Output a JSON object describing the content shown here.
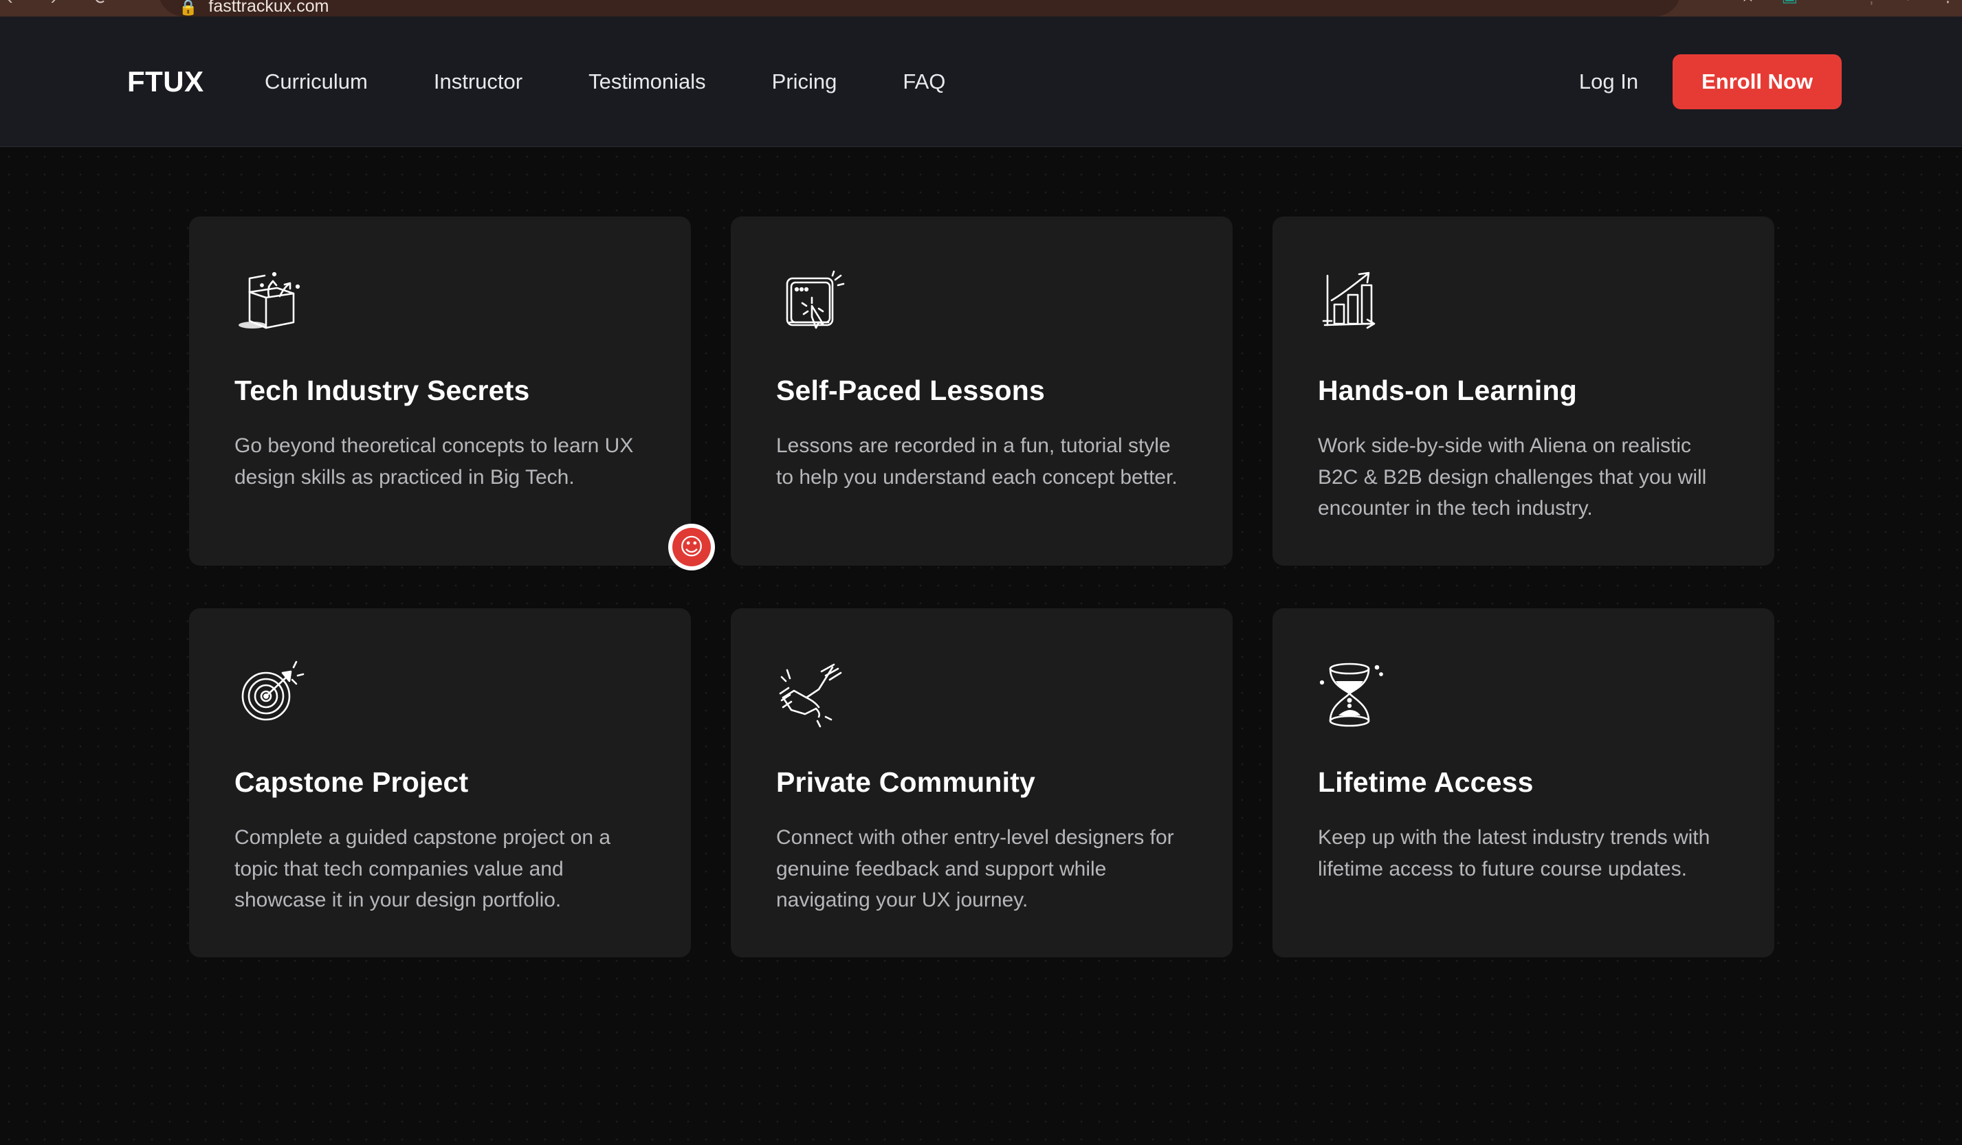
{
  "browser": {
    "url": "fasttrackux.com",
    "lock_icon": "lock-icon",
    "back_icon": "‹",
    "forward_icon": "›",
    "reload_icon": "⟳",
    "close_icon": "✕",
    "toolbar_icons": [
      {
        "name": "bookmark-star-icon",
        "glyph": "★",
        "cls": "ci-star"
      },
      {
        "name": "extension-green-icon",
        "glyph": "▣",
        "cls": "ci-green"
      },
      {
        "name": "extension-pink-icon",
        "glyph": "▭",
        "cls": "ci-pink"
      },
      {
        "name": "toolbar-divider",
        "glyph": "┊",
        "cls": "ci-bar"
      },
      {
        "name": "profile-avatar-icon",
        "glyph": "●",
        "cls": "ci-purple"
      },
      {
        "name": "browser-menu-icon",
        "glyph": "⋮",
        "cls": "ci-dots"
      }
    ]
  },
  "nav": {
    "brand": "FTUX",
    "links": [
      {
        "label": "Curriculum",
        "name": "nav-link-curriculum"
      },
      {
        "label": "Instructor",
        "name": "nav-link-instructor"
      },
      {
        "label": "Testimonials",
        "name": "nav-link-testimonials"
      },
      {
        "label": "Pricing",
        "name": "nav-link-pricing"
      },
      {
        "label": "FAQ",
        "name": "nav-link-faq"
      }
    ],
    "login_label": "Log In",
    "enroll_label": "Enroll Now",
    "enroll_color": "#e63b35",
    "background_color": "#1a1b20"
  },
  "features": {
    "cards": [
      {
        "title": "Tech Industry Secrets",
        "desc": "Go beyond theoretical concepts to learn UX design skills as practiced in Big Tech.",
        "icon": "open-box-sparkle-icon"
      },
      {
        "title": "Self-Paced Lessons",
        "desc": "Lessons are recorded in a fun, tutorial style to help you understand each concept better.",
        "icon": "browser-window-cursor-icon"
      },
      {
        "title": "Hands-on Learning",
        "desc": "Work side-by-side with Aliena on realistic B2C & B2B design challenges that you will encounter in the tech industry.",
        "icon": "bar-chart-growth-icon"
      },
      {
        "title": "Capstone Project",
        "desc": "Complete a guided capstone project on a topic that tech companies value and showcase it in your design portfolio.",
        "icon": "target-dart-icon"
      },
      {
        "title": "Private Community",
        "desc": "Connect with other entry-level designers for genuine feedback and support while navigating your UX journey.",
        "icon": "handshake-icon"
      },
      {
        "title": "Lifetime Access",
        "desc": "Keep up with the latest industry trends with lifetime access to future course updates.",
        "icon": "hourglass-icon"
      }
    ],
    "card_background": "#1c1c1d",
    "page_background": "#0c0c0d"
  },
  "cursor": {
    "name": "cursor-smiley-marker",
    "face": "☺",
    "color": "#e03a35"
  }
}
